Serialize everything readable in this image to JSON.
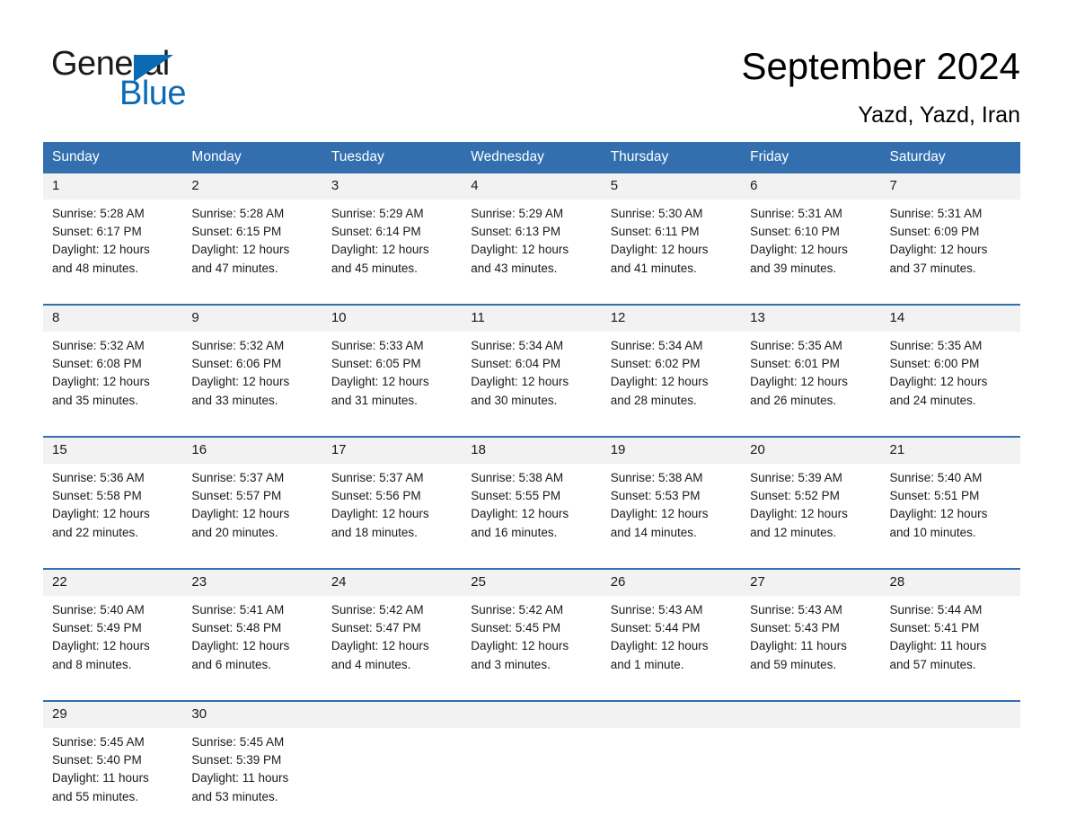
{
  "brand": {
    "name_part1": "General",
    "name_part2": "Blue",
    "triangle_icon": "triangle-icon",
    "color_dark": "#1a1a1a",
    "color_blue": "#0a6ab4"
  },
  "header": {
    "title": "September 2024",
    "location": "Yazd, Yazd, Iran"
  },
  "theme": {
    "header_blue": "#336FAF",
    "date_band": "#F2F2F2",
    "text": "#1a1a1a",
    "page_background": "#ffffff"
  },
  "calendar": {
    "weekday_headers": [
      "Sunday",
      "Monday",
      "Tuesday",
      "Wednesday",
      "Thursday",
      "Friday",
      "Saturday"
    ],
    "weeks": [
      {
        "dates": [
          "1",
          "2",
          "3",
          "4",
          "5",
          "6",
          "7"
        ],
        "cells": [
          {
            "sunrise": "Sunrise: 5:28 AM",
            "sunset": "Sunset: 6:17 PM",
            "daylight1": "Daylight: 12 hours",
            "daylight2": "and 48 minutes."
          },
          {
            "sunrise": "Sunrise: 5:28 AM",
            "sunset": "Sunset: 6:15 PM",
            "daylight1": "Daylight: 12 hours",
            "daylight2": "and 47 minutes."
          },
          {
            "sunrise": "Sunrise: 5:29 AM",
            "sunset": "Sunset: 6:14 PM",
            "daylight1": "Daylight: 12 hours",
            "daylight2": "and 45 minutes."
          },
          {
            "sunrise": "Sunrise: 5:29 AM",
            "sunset": "Sunset: 6:13 PM",
            "daylight1": "Daylight: 12 hours",
            "daylight2": "and 43 minutes."
          },
          {
            "sunrise": "Sunrise: 5:30 AM",
            "sunset": "Sunset: 6:11 PM",
            "daylight1": "Daylight: 12 hours",
            "daylight2": "and 41 minutes."
          },
          {
            "sunrise": "Sunrise: 5:31 AM",
            "sunset": "Sunset: 6:10 PM",
            "daylight1": "Daylight: 12 hours",
            "daylight2": "and 39 minutes."
          },
          {
            "sunrise": "Sunrise: 5:31 AM",
            "sunset": "Sunset: 6:09 PM",
            "daylight1": "Daylight: 12 hours",
            "daylight2": "and 37 minutes."
          }
        ]
      },
      {
        "dates": [
          "8",
          "9",
          "10",
          "11",
          "12",
          "13",
          "14"
        ],
        "cells": [
          {
            "sunrise": "Sunrise: 5:32 AM",
            "sunset": "Sunset: 6:08 PM",
            "daylight1": "Daylight: 12 hours",
            "daylight2": "and 35 minutes."
          },
          {
            "sunrise": "Sunrise: 5:32 AM",
            "sunset": "Sunset: 6:06 PM",
            "daylight1": "Daylight: 12 hours",
            "daylight2": "and 33 minutes."
          },
          {
            "sunrise": "Sunrise: 5:33 AM",
            "sunset": "Sunset: 6:05 PM",
            "daylight1": "Daylight: 12 hours",
            "daylight2": "and 31 minutes."
          },
          {
            "sunrise": "Sunrise: 5:34 AM",
            "sunset": "Sunset: 6:04 PM",
            "daylight1": "Daylight: 12 hours",
            "daylight2": "and 30 minutes."
          },
          {
            "sunrise": "Sunrise: 5:34 AM",
            "sunset": "Sunset: 6:02 PM",
            "daylight1": "Daylight: 12 hours",
            "daylight2": "and 28 minutes."
          },
          {
            "sunrise": "Sunrise: 5:35 AM",
            "sunset": "Sunset: 6:01 PM",
            "daylight1": "Daylight: 12 hours",
            "daylight2": "and 26 minutes."
          },
          {
            "sunrise": "Sunrise: 5:35 AM",
            "sunset": "Sunset: 6:00 PM",
            "daylight1": "Daylight: 12 hours",
            "daylight2": "and 24 minutes."
          }
        ]
      },
      {
        "dates": [
          "15",
          "16",
          "17",
          "18",
          "19",
          "20",
          "21"
        ],
        "cells": [
          {
            "sunrise": "Sunrise: 5:36 AM",
            "sunset": "Sunset: 5:58 PM",
            "daylight1": "Daylight: 12 hours",
            "daylight2": "and 22 minutes."
          },
          {
            "sunrise": "Sunrise: 5:37 AM",
            "sunset": "Sunset: 5:57 PM",
            "daylight1": "Daylight: 12 hours",
            "daylight2": "and 20 minutes."
          },
          {
            "sunrise": "Sunrise: 5:37 AM",
            "sunset": "Sunset: 5:56 PM",
            "daylight1": "Daylight: 12 hours",
            "daylight2": "and 18 minutes."
          },
          {
            "sunrise": "Sunrise: 5:38 AM",
            "sunset": "Sunset: 5:55 PM",
            "daylight1": "Daylight: 12 hours",
            "daylight2": "and 16 minutes."
          },
          {
            "sunrise": "Sunrise: 5:38 AM",
            "sunset": "Sunset: 5:53 PM",
            "daylight1": "Daylight: 12 hours",
            "daylight2": "and 14 minutes."
          },
          {
            "sunrise": "Sunrise: 5:39 AM",
            "sunset": "Sunset: 5:52 PM",
            "daylight1": "Daylight: 12 hours",
            "daylight2": "and 12 minutes."
          },
          {
            "sunrise": "Sunrise: 5:40 AM",
            "sunset": "Sunset: 5:51 PM",
            "daylight1": "Daylight: 12 hours",
            "daylight2": "and 10 minutes."
          }
        ]
      },
      {
        "dates": [
          "22",
          "23",
          "24",
          "25",
          "26",
          "27",
          "28"
        ],
        "cells": [
          {
            "sunrise": "Sunrise: 5:40 AM",
            "sunset": "Sunset: 5:49 PM",
            "daylight1": "Daylight: 12 hours",
            "daylight2": "and 8 minutes."
          },
          {
            "sunrise": "Sunrise: 5:41 AM",
            "sunset": "Sunset: 5:48 PM",
            "daylight1": "Daylight: 12 hours",
            "daylight2": "and 6 minutes."
          },
          {
            "sunrise": "Sunrise: 5:42 AM",
            "sunset": "Sunset: 5:47 PM",
            "daylight1": "Daylight: 12 hours",
            "daylight2": "and 4 minutes."
          },
          {
            "sunrise": "Sunrise: 5:42 AM",
            "sunset": "Sunset: 5:45 PM",
            "daylight1": "Daylight: 12 hours",
            "daylight2": "and 3 minutes."
          },
          {
            "sunrise": "Sunrise: 5:43 AM",
            "sunset": "Sunset: 5:44 PM",
            "daylight1": "Daylight: 12 hours",
            "daylight2": "and 1 minute."
          },
          {
            "sunrise": "Sunrise: 5:43 AM",
            "sunset": "Sunset: 5:43 PM",
            "daylight1": "Daylight: 11 hours",
            "daylight2": "and 59 minutes."
          },
          {
            "sunrise": "Sunrise: 5:44 AM",
            "sunset": "Sunset: 5:41 PM",
            "daylight1": "Daylight: 11 hours",
            "daylight2": "and 57 minutes."
          }
        ]
      },
      {
        "dates": [
          "29",
          "30",
          "",
          "",
          "",
          "",
          ""
        ],
        "cells": [
          {
            "sunrise": "Sunrise: 5:45 AM",
            "sunset": "Sunset: 5:40 PM",
            "daylight1": "Daylight: 11 hours",
            "daylight2": "and 55 minutes."
          },
          {
            "sunrise": "Sunrise: 5:45 AM",
            "sunset": "Sunset: 5:39 PM",
            "daylight1": "Daylight: 11 hours",
            "daylight2": "and 53 minutes."
          },
          {
            "sunrise": "",
            "sunset": "",
            "daylight1": "",
            "daylight2": ""
          },
          {
            "sunrise": "",
            "sunset": "",
            "daylight1": "",
            "daylight2": ""
          },
          {
            "sunrise": "",
            "sunset": "",
            "daylight1": "",
            "daylight2": ""
          },
          {
            "sunrise": "",
            "sunset": "",
            "daylight1": "",
            "daylight2": ""
          },
          {
            "sunrise": "",
            "sunset": "",
            "daylight1": "",
            "daylight2": ""
          }
        ]
      }
    ]
  }
}
